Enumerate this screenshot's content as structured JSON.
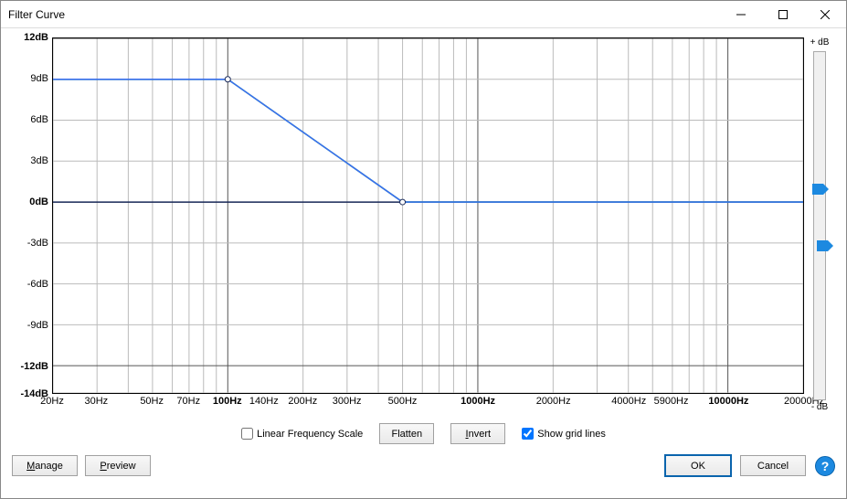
{
  "window": {
    "title": "Filter Curve"
  },
  "y_ticks": [
    {
      "label": "12dB",
      "db": 12,
      "bold": true
    },
    {
      "label": "9dB",
      "db": 9,
      "bold": false
    },
    {
      "label": "6dB",
      "db": 6,
      "bold": false
    },
    {
      "label": "3dB",
      "db": 3,
      "bold": false
    },
    {
      "label": "0dB",
      "db": 0,
      "bold": true
    },
    {
      "label": "-3dB",
      "db": -3,
      "bold": false
    },
    {
      "label": "-6dB",
      "db": -6,
      "bold": false
    },
    {
      "label": "-9dB",
      "db": -9,
      "bold": false
    },
    {
      "label": "-12dB",
      "db": -12,
      "bold": true
    },
    {
      "label": "-14dB",
      "db": -14,
      "bold": true
    }
  ],
  "x_ticks": [
    {
      "label": "20Hz",
      "hz": 20,
      "bold": false
    },
    {
      "label": "30Hz",
      "hz": 30,
      "bold": false
    },
    {
      "label": "50Hz",
      "hz": 50,
      "bold": false
    },
    {
      "label": "70Hz",
      "hz": 70,
      "bold": false
    },
    {
      "label": "100Hz",
      "hz": 100,
      "bold": true
    },
    {
      "label": "140Hz",
      "hz": 140,
      "bold": false
    },
    {
      "label": "200Hz",
      "hz": 200,
      "bold": false
    },
    {
      "label": "300Hz",
      "hz": 300,
      "bold": false
    },
    {
      "label": "500Hz",
      "hz": 500,
      "bold": false
    },
    {
      "label": "1000Hz",
      "hz": 1000,
      "bold": true
    },
    {
      "label": "2000Hz",
      "hz": 2000,
      "bold": false
    },
    {
      "label": "4000Hz",
      "hz": 4000,
      "bold": false
    },
    {
      "label": "5900Hz",
      "hz": 5900,
      "bold": false
    },
    {
      "label": "10000Hz",
      "hz": 10000,
      "bold": true
    },
    {
      "label": "20000Hz",
      "hz": 20000,
      "bold": false
    }
  ],
  "x_gridlines_hz": [
    20,
    30,
    40,
    50,
    60,
    70,
    80,
    90,
    100,
    200,
    300,
    400,
    500,
    600,
    700,
    800,
    900,
    1000,
    2000,
    3000,
    4000,
    5000,
    6000,
    7000,
    8000,
    9000,
    10000,
    20000
  ],
  "y_gridlines_db": [
    12,
    9,
    6,
    3,
    0,
    -3,
    -6,
    -9,
    -12,
    -14
  ],
  "slider": {
    "top_label": "+ dB",
    "bottom_label": "- dB"
  },
  "controls": {
    "linear_scale_label": "Linear Frequency Scale",
    "linear_scale_checked": false,
    "flatten": "Flatten",
    "invert": "Invert",
    "show_grid_label": "Show grid lines",
    "show_grid_checked": true
  },
  "buttons": {
    "manage": "Manage",
    "preview": "Preview",
    "ok": "OK",
    "cancel": "Cancel",
    "help": "?"
  },
  "chart_data": {
    "type": "line",
    "x_scale": "log",
    "x_range_hz": [
      20,
      20000
    ],
    "y_range_db": [
      -14,
      12
    ],
    "series": [
      {
        "name": "curve-green",
        "color": "#2fd24a",
        "points": [
          {
            "hz": 20,
            "db": 9
          },
          {
            "hz": 100,
            "db": 9
          },
          {
            "hz": 500,
            "db": 0
          },
          {
            "hz": 20000,
            "db": 0
          }
        ]
      },
      {
        "name": "curve-blue",
        "color": "#3a6df0",
        "points": [
          {
            "hz": 20,
            "db": 9
          },
          {
            "hz": 100,
            "db": 9
          },
          {
            "hz": 500,
            "db": 0
          },
          {
            "hz": 20000,
            "db": 0
          }
        ]
      }
    ],
    "control_points": [
      {
        "hz": 100,
        "db": 9
      },
      {
        "hz": 500,
        "db": 0
      }
    ]
  }
}
